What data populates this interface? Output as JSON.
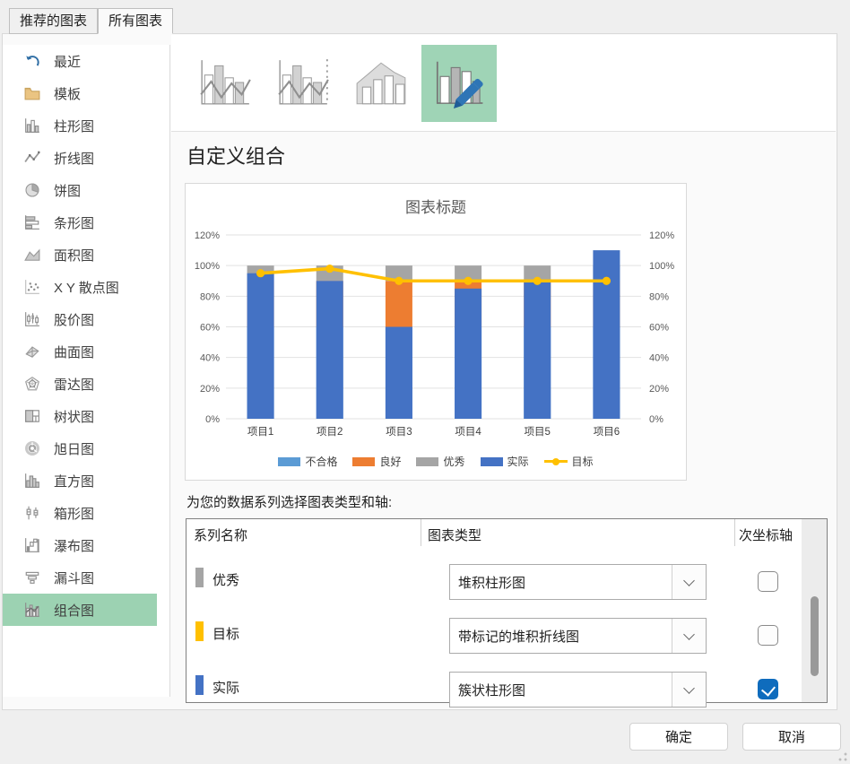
{
  "tabs": [
    {
      "id": "recommended",
      "label": "推荐的图表",
      "active": false
    },
    {
      "id": "all",
      "label": "所有图表",
      "active": true
    }
  ],
  "sidebar": {
    "items": [
      {
        "id": "recent",
        "label": "最近",
        "selected": false
      },
      {
        "id": "templates",
        "label": "模板",
        "selected": false
      },
      {
        "id": "column",
        "label": "柱形图",
        "selected": false
      },
      {
        "id": "line",
        "label": "折线图",
        "selected": false
      },
      {
        "id": "pie",
        "label": "饼图",
        "selected": false
      },
      {
        "id": "bar",
        "label": "条形图",
        "selected": false
      },
      {
        "id": "area",
        "label": "面积图",
        "selected": false
      },
      {
        "id": "scatter",
        "label": "X Y 散点图",
        "selected": false
      },
      {
        "id": "stock",
        "label": "股价图",
        "selected": false
      },
      {
        "id": "surface",
        "label": "曲面图",
        "selected": false
      },
      {
        "id": "radar",
        "label": "雷达图",
        "selected": false
      },
      {
        "id": "treemap",
        "label": "树状图",
        "selected": false
      },
      {
        "id": "sunburst",
        "label": "旭日图",
        "selected": false
      },
      {
        "id": "histogram",
        "label": "直方图",
        "selected": false
      },
      {
        "id": "boxwhisker",
        "label": "箱形图",
        "selected": false
      },
      {
        "id": "waterfall",
        "label": "瀑布图",
        "selected": false
      },
      {
        "id": "funnel",
        "label": "漏斗图",
        "selected": false
      },
      {
        "id": "combo",
        "label": "组合图",
        "selected": true
      }
    ]
  },
  "combo_types": [
    {
      "id": "clustered-column-line",
      "selected": false
    },
    {
      "id": "clustered-column-line-secondary-axis",
      "selected": false
    },
    {
      "id": "stacked-area-clustered-column",
      "selected": false
    },
    {
      "id": "custom-combination",
      "selected": true
    }
  ],
  "section_title": "自定义组合",
  "chart_data": {
    "type": "combo",
    "title": "图表标题",
    "categories": [
      "项目1",
      "项目2",
      "项目3",
      "项目4",
      "项目5",
      "项目6"
    ],
    "series": [
      {
        "name": "不合格",
        "type": "stacked-column",
        "color": "#5B9BD5",
        "values": [
          60,
          60,
          60,
          60,
          60,
          60
        ]
      },
      {
        "name": "良好",
        "type": "stacked-column",
        "color": "#ED7D31",
        "values": [
          30,
          30,
          30,
          30,
          30,
          30
        ]
      },
      {
        "name": "优秀",
        "type": "stacked-column",
        "color": "#A5A5A5",
        "values": [
          10,
          10,
          10,
          10,
          10,
          10
        ]
      },
      {
        "name": "实际",
        "type": "clustered-column",
        "axis": "secondary",
        "color": "#4472C4",
        "values": [
          95,
          90,
          60,
          85,
          90,
          110
        ]
      },
      {
        "name": "目标",
        "type": "line-markers",
        "color": "#FFC000",
        "values": [
          95,
          98,
          90,
          90,
          90,
          90
        ]
      }
    ],
    "ylim": [
      0,
      120
    ],
    "y2lim": [
      0,
      120
    ],
    "tick_step": 20,
    "tick_format": "percent",
    "tick_labels": [
      "0%",
      "20%",
      "40%",
      "60%",
      "80%",
      "100%",
      "120%"
    ],
    "grid": true,
    "legend_position": "bottom"
  },
  "series_picker": {
    "instruction": "为您的数据系列选择图表类型和轴:",
    "headers": [
      "系列名称",
      "图表类型",
      "次坐标轴"
    ],
    "rows": [
      {
        "label": "优秀",
        "color": "#A5A5A5",
        "chart_type": "堆积柱形图",
        "secondary_axis": false
      },
      {
        "label": "目标",
        "color": "#FFC000",
        "chart_type": "带标记的堆积折线图",
        "secondary_axis": false
      },
      {
        "label": "实际",
        "color": "#4472C4",
        "chart_type": "簇状柱形图",
        "secondary_axis": true
      }
    ]
  },
  "footer": {
    "ok_label": "确定",
    "cancel_label": "取消"
  },
  "colors": {
    "selection_green": "#9CD2B2",
    "checkbox_accent": "#0F6CBD",
    "axis_text": "#595959",
    "gridline": "#E2E2E2",
    "pencil_blue": "#2E75B6"
  }
}
